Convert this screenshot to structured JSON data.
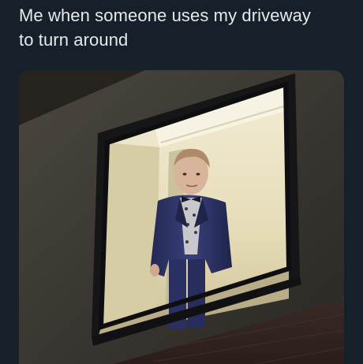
{
  "tweet": {
    "caption_line1": "Me when someone uses my driveway",
    "caption_line2": "to turn around"
  },
  "media": {
    "subject": "boy-in-suit-at-window",
    "colors": {
      "background": "#15202b",
      "text": "#e7e9ea",
      "wall": "#3a3833",
      "window_frame": "#1a1a1c",
      "interior_light": "#e8e2c8",
      "suit": "#2e3466"
    }
  }
}
